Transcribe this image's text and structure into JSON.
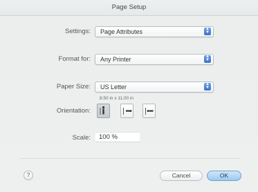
{
  "window": {
    "title": "Page Setup"
  },
  "settings": {
    "label": "Settings:",
    "value": "Page Attributes"
  },
  "format_for": {
    "label": "Format for:",
    "value": "Any Printer"
  },
  "paper_size": {
    "label": "Paper Size:",
    "value": "US Letter",
    "dimensions": "8.50 in x 11.00 in"
  },
  "orientation": {
    "label": "Orientation:",
    "options": [
      "portrait",
      "landscape-left",
      "landscape-right"
    ],
    "selected": "portrait"
  },
  "scale": {
    "label": "Scale:",
    "value": "100 %"
  },
  "footer": {
    "help_glyph": "?",
    "cancel_label": "Cancel",
    "ok_label": "OK"
  }
}
